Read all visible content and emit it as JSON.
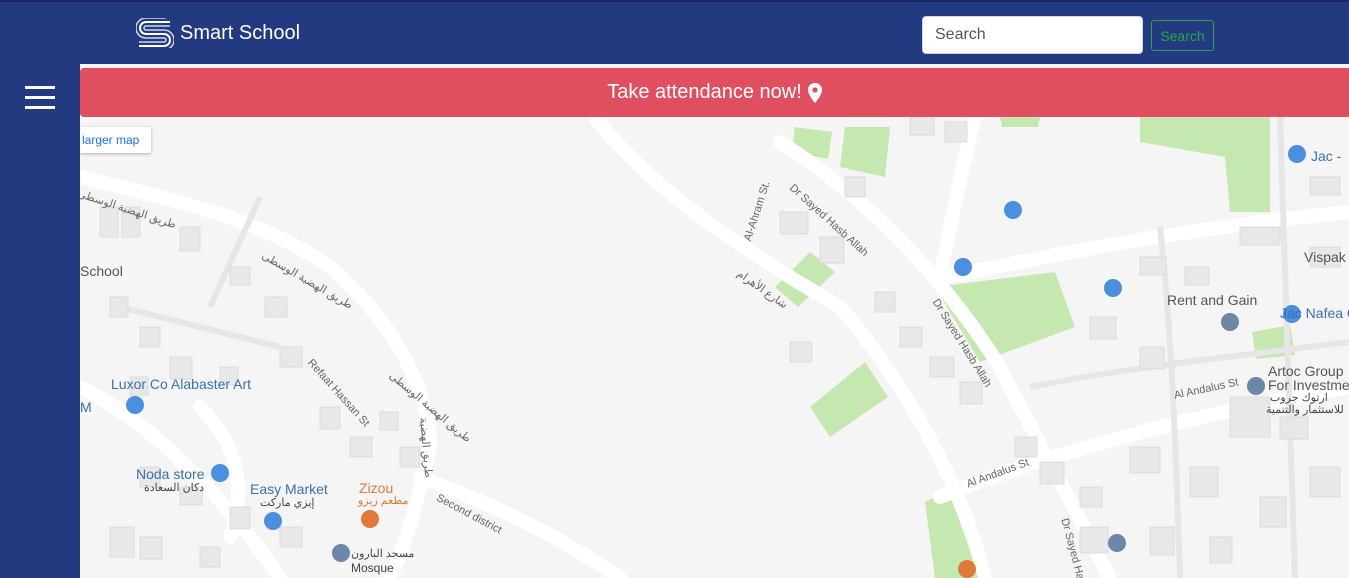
{
  "header": {
    "app_name": "Smart School",
    "search": {
      "placeholder": "Search",
      "button_label": "Search"
    }
  },
  "banner": {
    "text": "Take attendance now!"
  },
  "map": {
    "larger_map_link": "larger map",
    "labels": {
      "school": "School",
      "luxor": "Luxor Co Alabaster Art",
      "noda_en": "Noda store",
      "noda_ar": "دكان السعادة",
      "easy_en": "Easy Market",
      "easy_ar": "إيزي ماركت",
      "zizou_en": "Zizou",
      "zizou_ar": "مطعم زيزو",
      "mosque_ar": "مسجد البارون",
      "mosque_en": "Mosque",
      "rent": "Rent and Gain",
      "jac_nafea": "Jac Nafea C",
      "jac": "Jac -",
      "vispak": "Vispak",
      "artoc1": "Artoc Group",
      "artoc2": "For Investme",
      "artoc_ar1": "ارتوك جروب",
      "artoc_ar2": "للاستثمار والتنمية",
      "m": "M",
      "road_hadaba_1": "طريق الهضبة الوسطى",
      "road_hadaba_2": "طريق الهضبة الوسطى",
      "road_hadaba_3": "طريق الهضبة الوسطى",
      "road_hadaba_4": "طريق الهضبة",
      "refaat": "Refaat Hassan St",
      "second_district": "Second district",
      "al_ahram": "Al-Ahram St.",
      "ahram_ar": "شارع الأهرام",
      "sayed1": "Dr Sayed Hasb Allah",
      "sayed2": "Dr Sayed Hasb Allah",
      "sayed3": "Dr Sayed Hasb",
      "andalus1": "Al Andalus St",
      "andalus2": "Al Andalus St"
    }
  }
}
